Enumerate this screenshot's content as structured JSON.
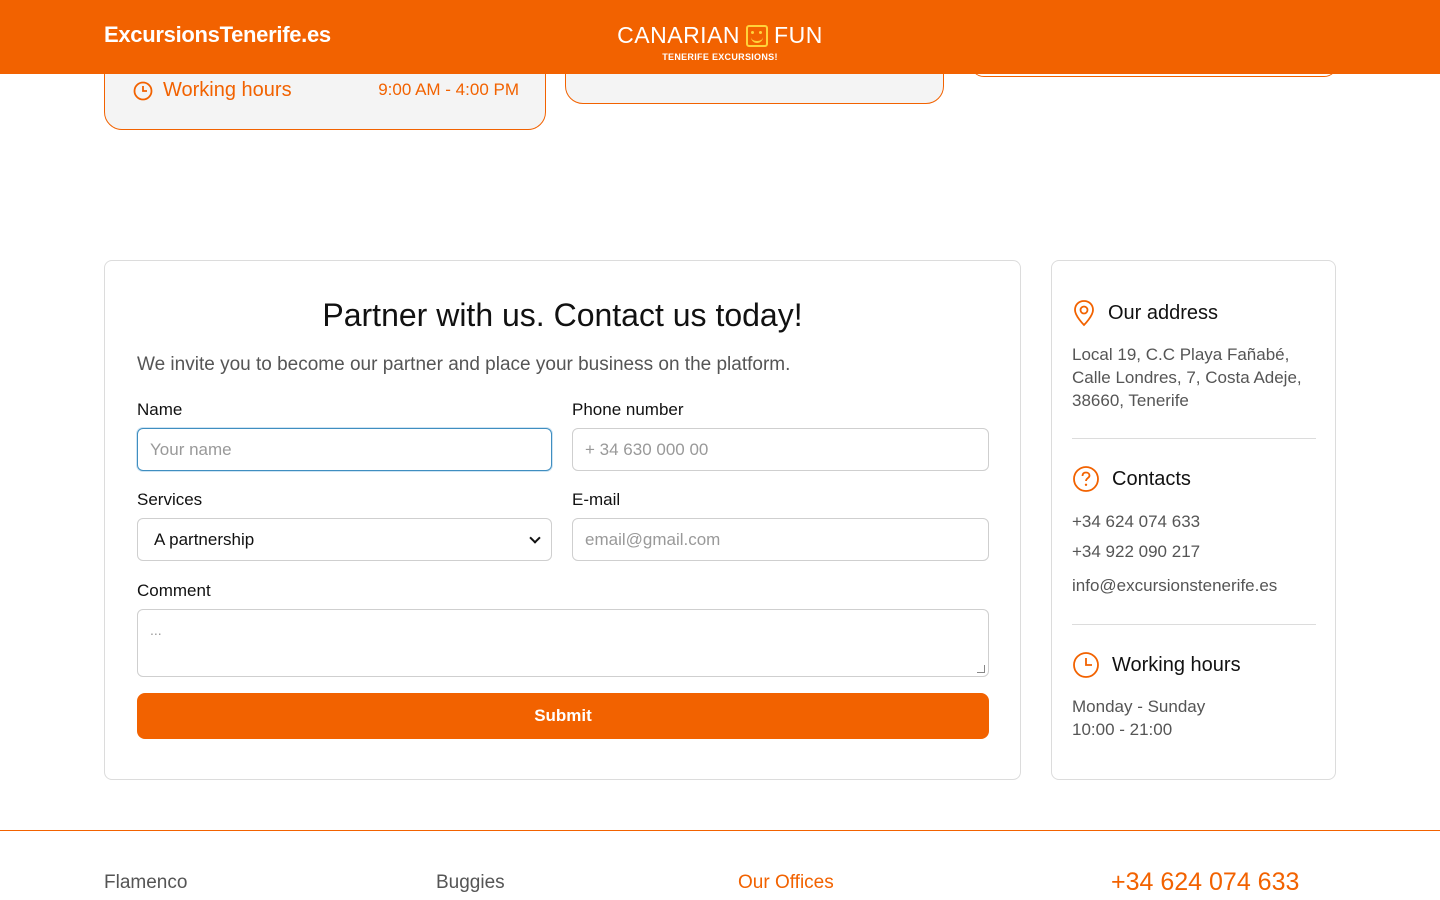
{
  "header": {
    "site_name": "ExcursionsTenerife.es",
    "logo_main_left": "CANARIAN",
    "logo_main_right": "FUN",
    "logo_sub": "TENERIFE EXCURSIONS!"
  },
  "top_card": {
    "label": "Working hours",
    "time": "9:00 AM - 4:00 PM"
  },
  "form": {
    "title": "Partner with us. Contact us today!",
    "intro": "We invite you to become our partner and place your business on the platform.",
    "name_label": "Name",
    "name_placeholder": "Your name",
    "phone_label": "Phone number",
    "phone_placeholder": "+ 34 630 000 00",
    "services_label": "Services",
    "services_value": "A partnership",
    "email_label": "E-mail",
    "email_placeholder": "email@gmail.com",
    "comment_label": "Comment",
    "comment_placeholder": "...",
    "submit_label": "Submit"
  },
  "side": {
    "address_title": "Our address",
    "address_lines": [
      "Local 19, C.C Playa Fañabé,",
      "Calle Londres, 7, Costa Adeje,",
      "38660, Tenerife"
    ],
    "contacts_title": "Contacts",
    "phone1": "+34 624 074 633",
    "phone2": "+34 922 090 217",
    "email": "info@excursionstenerife.es",
    "hours_title": "Working hours",
    "hours_days": "Monday - Sunday",
    "hours_time": "10:00 - 21:00"
  },
  "footer": {
    "link1": "Flamenco",
    "link2": "Buggies",
    "link3": "Our Offices",
    "phone": "+34 624 074 633"
  },
  "colors": {
    "accent": "#f26200",
    "focus_border": "#3f8ec0"
  }
}
